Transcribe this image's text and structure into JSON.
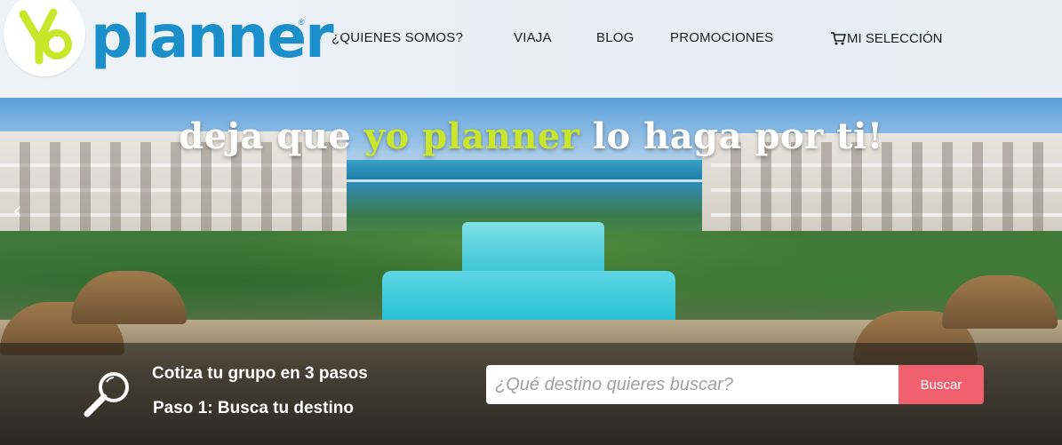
{
  "brand": {
    "name": "planner",
    "mark": "yo",
    "registered": "®",
    "color": "#1a8fc9",
    "accent": "#c8e62a"
  },
  "nav": {
    "items": [
      {
        "label": "¿QUIENES SOMOS?"
      },
      {
        "label": "VIAJA"
      },
      {
        "label": "BLOG"
      },
      {
        "label": "PROMOCIONES"
      }
    ],
    "cart_label": "MI SELECCIÓN",
    "cart_icon": "shopping-cart-icon"
  },
  "hero": {
    "title_pre": "deja que ",
    "title_highlight": "yo planner",
    "title_post": " lo haga por ti!",
    "prev_arrow": "‹"
  },
  "search": {
    "line1": "Cotiza tu grupo en 3 pasos",
    "line2": "Paso 1: Busca tu destino",
    "placeholder": "¿Qué destino quieres buscar?",
    "button_label": "Buscar",
    "button_color": "#f0606f",
    "icon": "magnifier-icon"
  }
}
